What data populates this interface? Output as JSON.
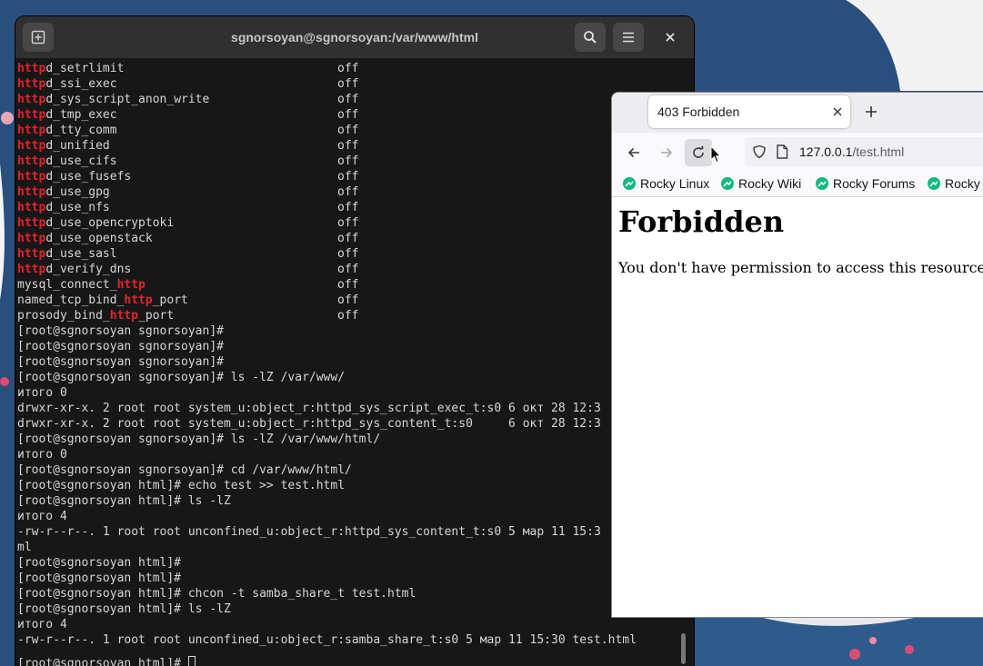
{
  "terminal": {
    "title": "sgnorsoyan@sgnorsoyan:/var/www/html",
    "sebool_rows": [
      {
        "pre": "",
        "hl": "http",
        "post": "d_setrlimit",
        "value": "off"
      },
      {
        "pre": "",
        "hl": "http",
        "post": "d_ssi_exec",
        "value": "off"
      },
      {
        "pre": "",
        "hl": "http",
        "post": "d_sys_script_anon_write",
        "value": "off"
      },
      {
        "pre": "",
        "hl": "http",
        "post": "d_tmp_exec",
        "value": "off"
      },
      {
        "pre": "",
        "hl": "http",
        "post": "d_tty_comm",
        "value": "off"
      },
      {
        "pre": "",
        "hl": "http",
        "post": "d_unified",
        "value": "off"
      },
      {
        "pre": "",
        "hl": "http",
        "post": "d_use_cifs",
        "value": "off"
      },
      {
        "pre": "",
        "hl": "http",
        "post": "d_use_fusefs",
        "value": "off"
      },
      {
        "pre": "",
        "hl": "http",
        "post": "d_use_gpg",
        "value": "off"
      },
      {
        "pre": "",
        "hl": "http",
        "post": "d_use_nfs",
        "value": "off"
      },
      {
        "pre": "",
        "hl": "http",
        "post": "d_use_opencryptoki",
        "value": "off"
      },
      {
        "pre": "",
        "hl": "http",
        "post": "d_use_openstack",
        "value": "off"
      },
      {
        "pre": "",
        "hl": "http",
        "post": "d_use_sasl",
        "value": "off"
      },
      {
        "pre": "",
        "hl": "http",
        "post": "d_verify_dns",
        "value": "off"
      },
      {
        "pre": "mysql_connect_",
        "hl": "http",
        "post": "",
        "value": "off"
      },
      {
        "pre": "named_tcp_bind_",
        "hl": "http",
        "post": "_port",
        "value": "off"
      },
      {
        "pre": "prosody_bind_",
        "hl": "http",
        "post": "_port",
        "value": "off"
      }
    ],
    "lines": [
      "[root@sgnorsoyan sgnorsoyan]#",
      "[root@sgnorsoyan sgnorsoyan]#",
      "[root@sgnorsoyan sgnorsoyan]#",
      "[root@sgnorsoyan sgnorsoyan]# ls -lZ /var/www/",
      "итого 0",
      "drwxr-xr-x. 2 root root system_u:object_r:httpd_sys_script_exec_t:s0 6 окт 28 12:3",
      "drwxr-xr-x. 2 root root system_u:object_r:httpd_sys_content_t:s0     6 окт 28 12:3",
      "[root@sgnorsoyan sgnorsoyan]# ls -lZ /var/www/html/",
      "итого 0",
      "[root@sgnorsoyan sgnorsoyan]# cd /var/www/html/",
      "[root@sgnorsoyan html]# echo test >> test.html",
      "[root@sgnorsoyan html]# ls -lZ",
      "итого 4",
      "-rw-r--r--. 1 root root unconfined_u:object_r:httpd_sys_content_t:s0 5 мар 11 15:3",
      "ml",
      "[root@sgnorsoyan html]#",
      "[root@sgnorsoyan html]#",
      "[root@sgnorsoyan html]# chcon -t samba_share_t test.html",
      "[root@sgnorsoyan html]# ls -lZ",
      "итого 4",
      "-rw-r--r--. 1 root root unconfined_u:object_r:samba_share_t:s0 5 мар 11 15:30 test.html"
    ],
    "prompt": "[root@sgnorsoyan html]# ",
    "highlight_color": "#e5222c",
    "icons": {
      "new_tab": "new-tab-icon",
      "search": "search-icon",
      "menu": "hamburger-menu-icon",
      "close": "close-icon"
    }
  },
  "browser": {
    "tab_title": "403 Forbidden",
    "url_host": "127.0.0.1",
    "url_path": "/test.html",
    "bookmarks": [
      "Rocky Linux",
      "Rocky Wiki",
      "Rocky Forums",
      "Rocky"
    ],
    "bookmark_icon_color": "#10b981",
    "page": {
      "heading": "Forbidden",
      "message": "You don't have permission to access this resource."
    }
  },
  "desktop": {
    "wallpaper": "Rocky Linux blue wallpaper with white swoosh and cherry blossoms"
  }
}
